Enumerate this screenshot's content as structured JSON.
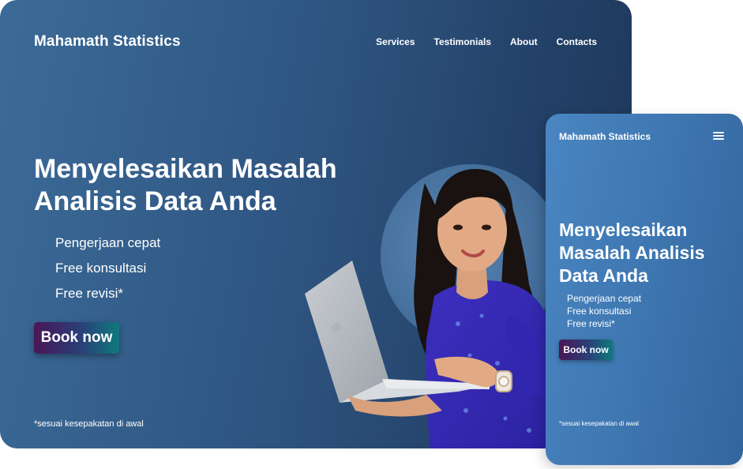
{
  "desktop": {
    "brand": "Mahamath Statistics",
    "nav": [
      "Services",
      "Testimonials",
      "About",
      "Contacts"
    ],
    "hero_title_line1": "Menyelesaikan Masalah",
    "hero_title_line2": "Analisis Data Anda",
    "features": [
      "Pengerjaan cepat",
      "Free konsultasi",
      "Free revisi*"
    ],
    "cta_label": "Book now",
    "footnote": "*sesuai kesepakatan di awal"
  },
  "mobile": {
    "brand": "Mahamath Statistics",
    "menu_icon": "hamburger-menu-icon",
    "hero_title_line1": "Menyelesaikan",
    "hero_title_line2": "Masalah Analisis",
    "hero_title_line3": "Data Anda",
    "features": [
      "Pengerjaan cepat",
      "Free konsultasi",
      "Free revisi*"
    ],
    "cta_label": "Book now",
    "footnote": "*sesuai kesepakatan di awal"
  },
  "colors": {
    "background_dark": "#234168",
    "background_light": "#3c6b98",
    "mobile_background": "#3f78b2",
    "cta_gradient_start": "#4a1656",
    "cta_gradient_end": "#0f7a7c",
    "text": "#ffffff"
  }
}
